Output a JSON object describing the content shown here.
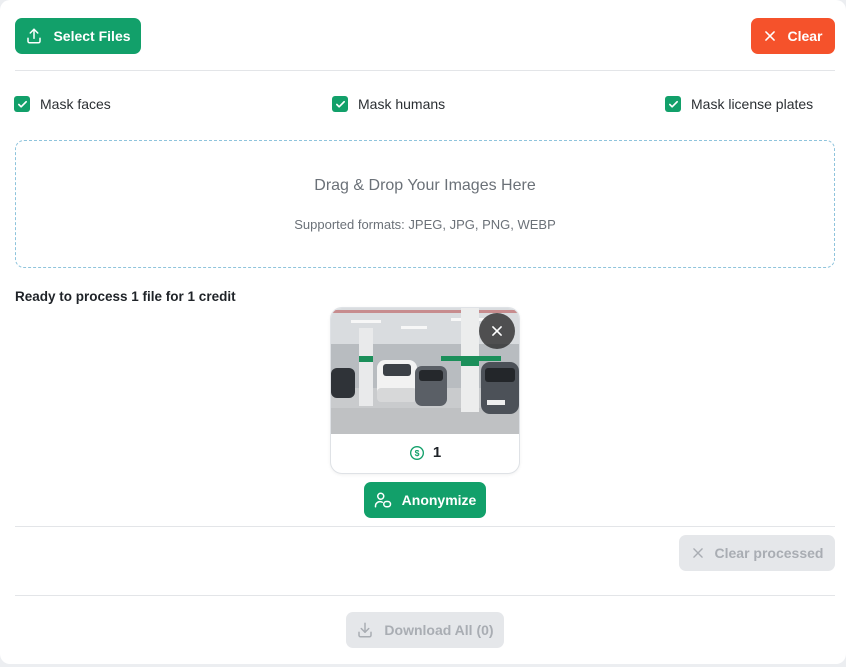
{
  "toolbar": {
    "select_files_label": "Select Files",
    "clear_label": "Clear"
  },
  "options": [
    {
      "label": "Mask faces",
      "checked": true
    },
    {
      "label": "Mask humans",
      "checked": true
    },
    {
      "label": "Mask license plates",
      "checked": true
    }
  ],
  "dropzone": {
    "title": "Drag & Drop Your Images Here",
    "formats": "Supported formats: JPEG, JPG, PNG, WEBP"
  },
  "status": {
    "ready_text": "Ready to process 1 file for 1 credit"
  },
  "file": {
    "credit_cost": "1"
  },
  "actions": {
    "anonymize_label": "Anonymize",
    "clear_processed_label": "Clear processed",
    "download_all_label": "Download All (0)"
  },
  "colors": {
    "accent": "#12a06a",
    "danger": "#f5522b",
    "disabled": "#e5e7ea"
  }
}
